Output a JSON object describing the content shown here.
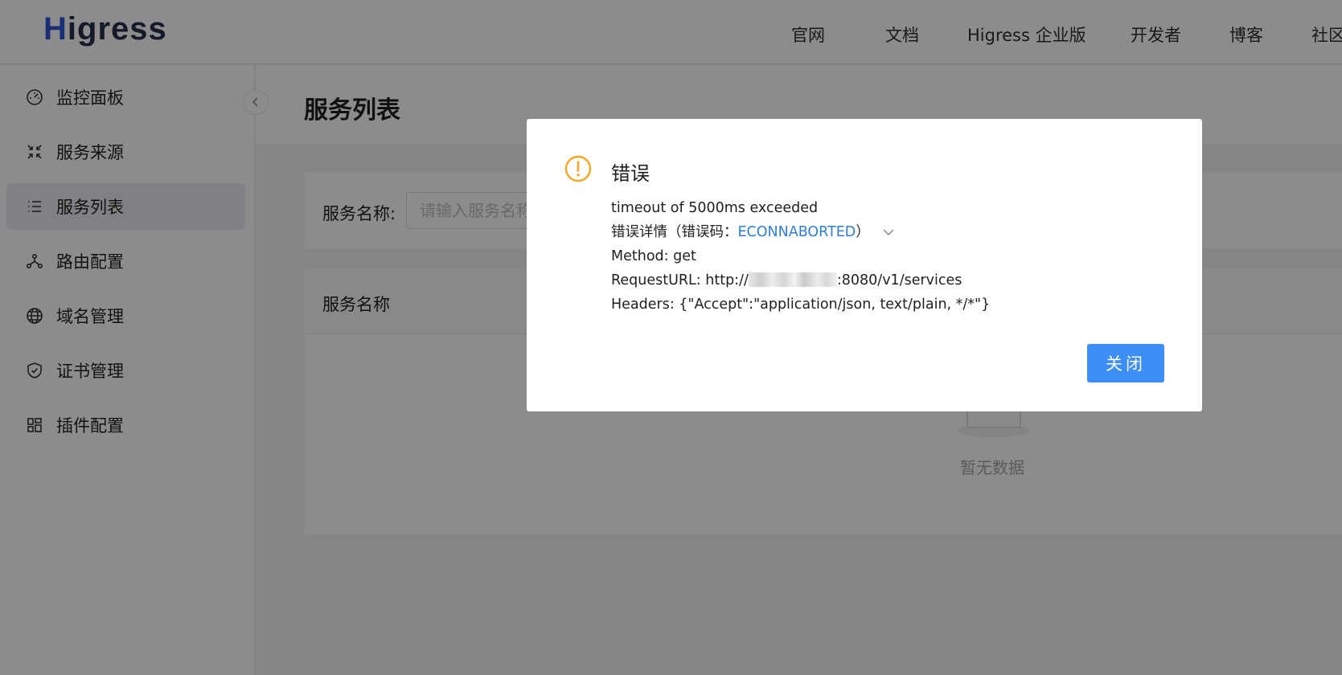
{
  "header": {
    "logo_first": "H",
    "logo_rest": "igress",
    "nav": [
      "官网",
      "文档",
      "Higress 企业版",
      "开发者",
      "博客",
      "社区"
    ]
  },
  "sidebar": {
    "items": [
      {
        "label": "监控面板",
        "icon": "dashboard-icon",
        "active": false
      },
      {
        "label": "服务来源",
        "icon": "compress-icon",
        "active": false
      },
      {
        "label": "服务列表",
        "icon": "list-icon",
        "active": true
      },
      {
        "label": "路由配置",
        "icon": "route-icon",
        "active": false
      },
      {
        "label": "域名管理",
        "icon": "globe-icon",
        "active": false
      },
      {
        "label": "证书管理",
        "icon": "shield-icon",
        "active": false
      },
      {
        "label": "插件配置",
        "icon": "plugin-icon",
        "active": false
      }
    ]
  },
  "main": {
    "title": "服务列表",
    "search": {
      "label": "服务名称:",
      "placeholder": "请输入服务名称",
      "value": ""
    },
    "table": {
      "columns": [
        "服务名称"
      ],
      "empty_text": "暂无数据"
    }
  },
  "modal": {
    "title": "错误",
    "message": "timeout of 5000ms exceeded",
    "detail_prefix": "错误详情（错误码：",
    "error_code": "ECONNABORTED",
    "detail_suffix": "）",
    "method": "Method: get",
    "request_url_prefix": "RequestURL: http://",
    "request_url_suffix": ":8080/v1/services",
    "headers": "Headers: {\"Accept\":\"application/json, text/plain, */*\"}",
    "close_label": "关闭"
  },
  "colors": {
    "primary": "#3e8ef7",
    "warning": "#f5a623",
    "link": "#2f7fd8",
    "logo_accent": "#2f55d4"
  }
}
